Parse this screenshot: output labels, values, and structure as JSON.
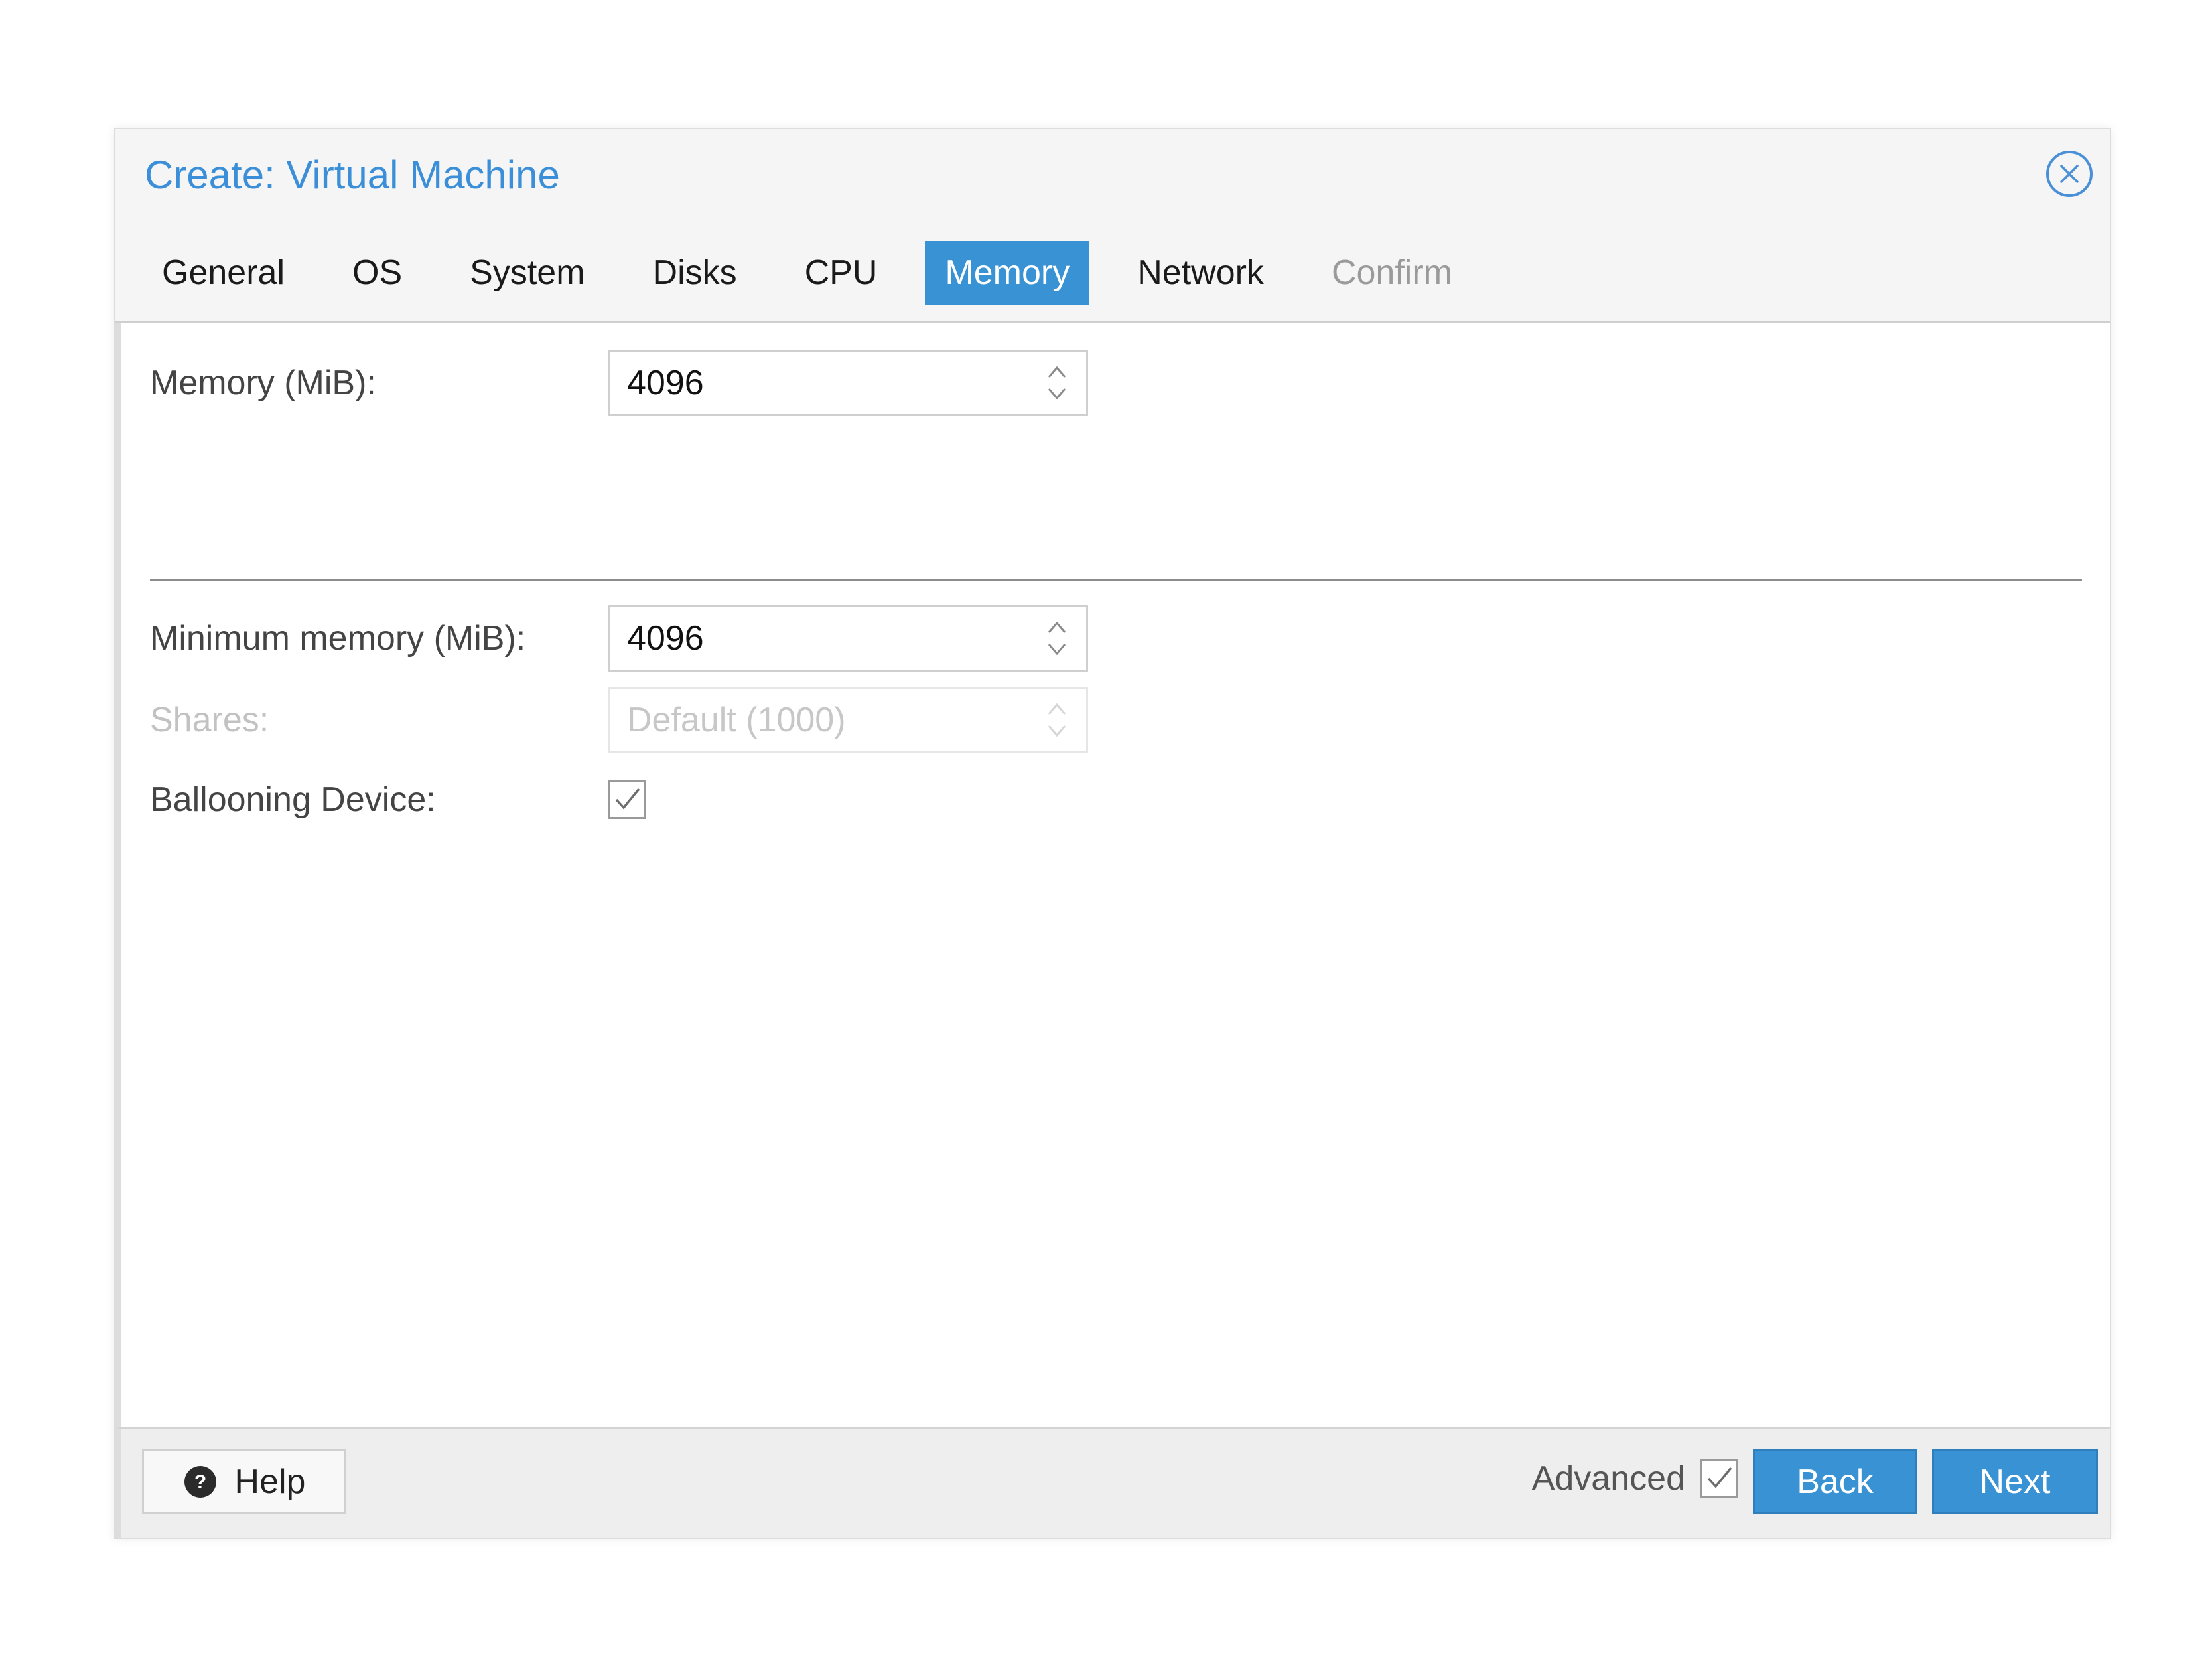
{
  "dialog": {
    "title": "Create: Virtual Machine"
  },
  "tabs": [
    {
      "label": "General",
      "state": "normal"
    },
    {
      "label": "OS",
      "state": "normal"
    },
    {
      "label": "System",
      "state": "normal"
    },
    {
      "label": "Disks",
      "state": "normal"
    },
    {
      "label": "CPU",
      "state": "normal"
    },
    {
      "label": "Memory",
      "state": "active"
    },
    {
      "label": "Network",
      "state": "normal"
    },
    {
      "label": "Confirm",
      "state": "disabled"
    }
  ],
  "form": {
    "memory": {
      "label": "Memory (MiB):",
      "value": "4096"
    },
    "min_memory": {
      "label": "Minimum memory (MiB):",
      "value": "4096"
    },
    "shares": {
      "label": "Shares:",
      "placeholder": "Default (1000)"
    },
    "ballooning": {
      "label": "Ballooning Device:",
      "checked": true
    }
  },
  "footer": {
    "help_label": "Help",
    "advanced_label": "Advanced",
    "advanced_checked": true,
    "back_label": "Back",
    "next_label": "Next"
  },
  "colors": {
    "accent": "#3892d4",
    "title": "#3a8fd8"
  },
  "icons": {
    "close": "close-circle-icon",
    "help": "question-circle-icon",
    "spinner": "spin-arrows-icon",
    "check": "checkmark-icon"
  }
}
